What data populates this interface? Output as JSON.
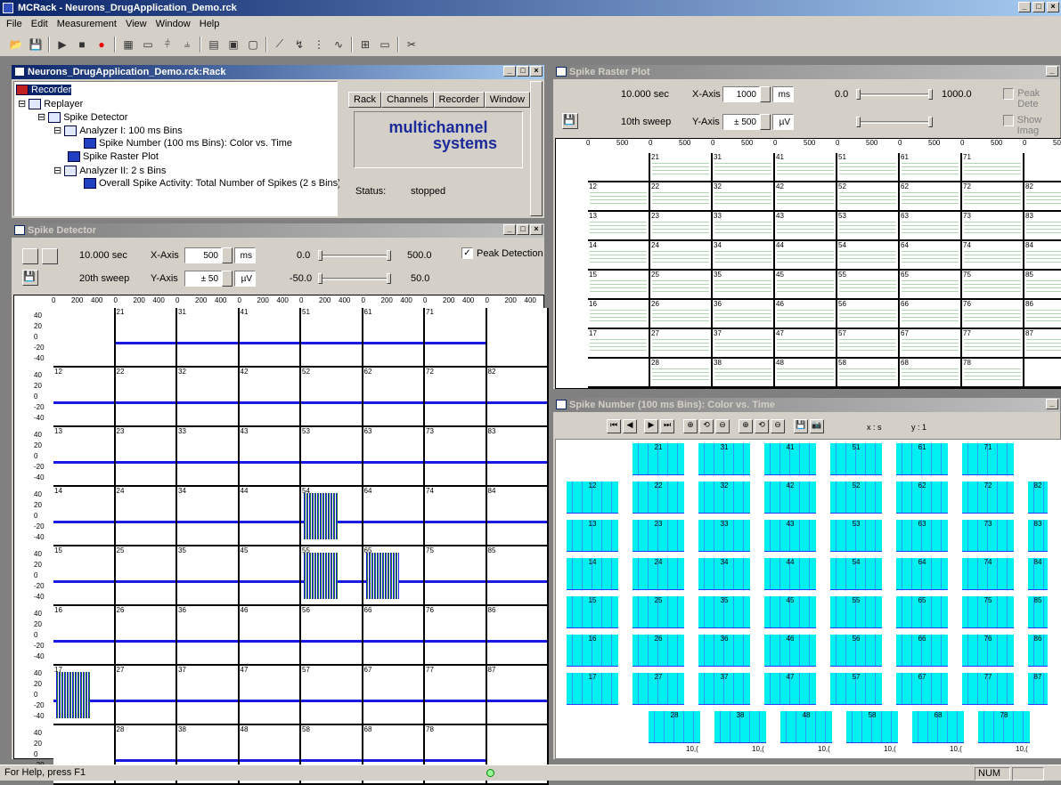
{
  "app": {
    "title": "MCRack - Neurons_DrugApplication_Demo.rck"
  },
  "menu": [
    "File",
    "Edit",
    "Measurement",
    "View",
    "Window",
    "Help"
  ],
  "rack": {
    "title": "Neurons_DrugApplication_Demo.rck:Rack",
    "tree": [
      "Recorder",
      "Replayer",
      "Spike Detector",
      "Analyzer I: 100 ms Bins",
      "Spike Number (100 ms Bins): Color vs. Time",
      "Spike Raster Plot",
      "Analyzer II: 2 s Bins",
      "Overall Spike Activity: Total Number of Spikes (2 s Bins)"
    ],
    "tabs": [
      "Rack",
      "Channels",
      "Recorder",
      "Window"
    ],
    "logo": [
      "multichannel",
      "systems"
    ],
    "status_label": "Status:",
    "status_value": "stopped"
  },
  "detector": {
    "title": "Spike Detector",
    "time": "10.000 sec",
    "sweep": "20th sweep",
    "xaxis_label": "X-Axis",
    "xaxis_value": "500",
    "xaxis_unit": "ms",
    "yaxis_label": "Y-Axis",
    "yaxis_value": "± 50",
    "yaxis_unit": "µV",
    "xmin": "0.0",
    "xmax": "500.0",
    "ymin": "-50.0",
    "ymax": "50.0",
    "peak": "Peak Detection",
    "ticks": [
      "0",
      "200",
      "400"
    ],
    "yticks": [
      "40",
      "20",
      "0",
      "-20",
      "-40"
    ],
    "grid": [
      [
        "",
        "21",
        "31",
        "41",
        "51",
        "61",
        "71",
        ""
      ],
      [
        "12",
        "22",
        "32",
        "42",
        "52",
        "62",
        "72",
        "82"
      ],
      [
        "13",
        "23",
        "33",
        "43",
        "53",
        "63",
        "73",
        "83"
      ],
      [
        "14",
        "24",
        "34",
        "44",
        "54",
        "64",
        "74",
        "84"
      ],
      [
        "15",
        "25",
        "35",
        "45",
        "55",
        "65",
        "75",
        "85"
      ],
      [
        "16",
        "26",
        "36",
        "46",
        "56",
        "66",
        "76",
        "86"
      ],
      [
        "17",
        "27",
        "37",
        "47",
        "57",
        "67",
        "77",
        "87"
      ],
      [
        "",
        "28",
        "38",
        "48",
        "58",
        "68",
        "78",
        ""
      ]
    ]
  },
  "raster": {
    "title": "Spike Raster Plot",
    "time": "10.000 sec",
    "sweep": "10th sweep",
    "xaxis_label": "X-Axis",
    "xaxis_value": "1000",
    "xaxis_unit": "ms",
    "yaxis_label": "Y-Axis",
    "yaxis_value": "± 500",
    "yaxis_unit": "µV",
    "xmin": "0.0",
    "xmax": "1000.0",
    "peak": "Peak Dete",
    "showimg": "Show Imag",
    "ticks": [
      "0",
      "500"
    ]
  },
  "spikenum": {
    "title": "Spike Number (100 ms Bins): Color vs. Time",
    "xlabel": "x : s",
    "ylabel": "y : 1",
    "axis_end": "10,("
  },
  "status": {
    "help": "For Help, press F1",
    "num": "NUM"
  }
}
